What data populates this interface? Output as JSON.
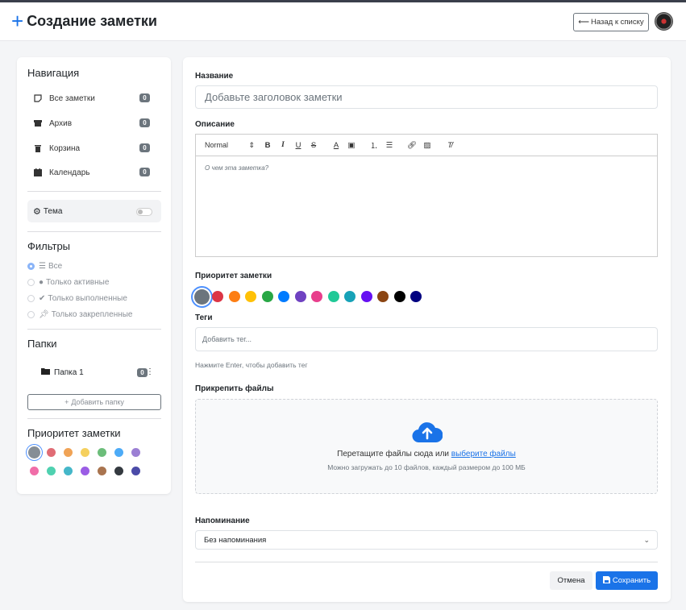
{
  "header": {
    "title": "Создание заметки",
    "back_label": "Назад к списку"
  },
  "sidebar": {
    "nav_title": "Навигация",
    "nav_items": [
      {
        "label": "Все заметки",
        "count": "0"
      },
      {
        "label": "Архив",
        "count": "0"
      },
      {
        "label": "Корзина",
        "count": "0"
      },
      {
        "label": "Календарь",
        "count": "0"
      }
    ],
    "theme_label": "Тема",
    "filters_title": "Фильтры",
    "filters": [
      {
        "label": "Все",
        "selected": true
      },
      {
        "label": "Только активные",
        "selected": false
      },
      {
        "label": "Только выполненные",
        "selected": false
      },
      {
        "label": "Только закрепленные",
        "selected": false
      }
    ],
    "folders_title": "Папки",
    "folders": [
      {
        "label": "Папка 1",
        "count": "0"
      }
    ],
    "add_folder_label": "Добавить папку",
    "priority_title": "Приоритет заметки",
    "priority_colors": [
      "#868e96",
      "#e06c75",
      "#f0a356",
      "#f5d05e",
      "#6cbd7a",
      "#4dabf7",
      "#9b7fd4",
      "#f06da8",
      "#4fd1b0",
      "#45b7c9",
      "#9b5de5",
      "#a9744f",
      "#343a40",
      "#4b4ba8"
    ]
  },
  "form": {
    "title_label": "Название",
    "title_placeholder": "Добавьте заголовок заметки",
    "desc_label": "Описание",
    "editor_format": "Normal",
    "editor_placeholder": "О чем эта заметка?",
    "priority_label": "Приоритет заметки",
    "priority_colors": [
      "#6c757d",
      "#dc3545",
      "#fd7e14",
      "#ffc107",
      "#28a745",
      "#007bff",
      "#6f42c1",
      "#e83e8c",
      "#20c997",
      "#17a2b8",
      "#6610f2",
      "#8b4513",
      "#000000",
      "#000080"
    ],
    "tags_label": "Теги",
    "tags_placeholder": "Добавить тег...",
    "tags_hint": "Нажмите Enter, чтобы добавить тег",
    "files_label": "Прикрепить файлы",
    "drop_text": "Перетащите файлы сюда или",
    "drop_link": "выберите файлы",
    "drop_limit": "Можно загружать до 10 файлов, каждый размером до 100 МБ",
    "reminder_label": "Напоминание",
    "reminder_value": "Без напоминания",
    "cancel_label": "Отмена",
    "save_label": "Сохранить"
  }
}
